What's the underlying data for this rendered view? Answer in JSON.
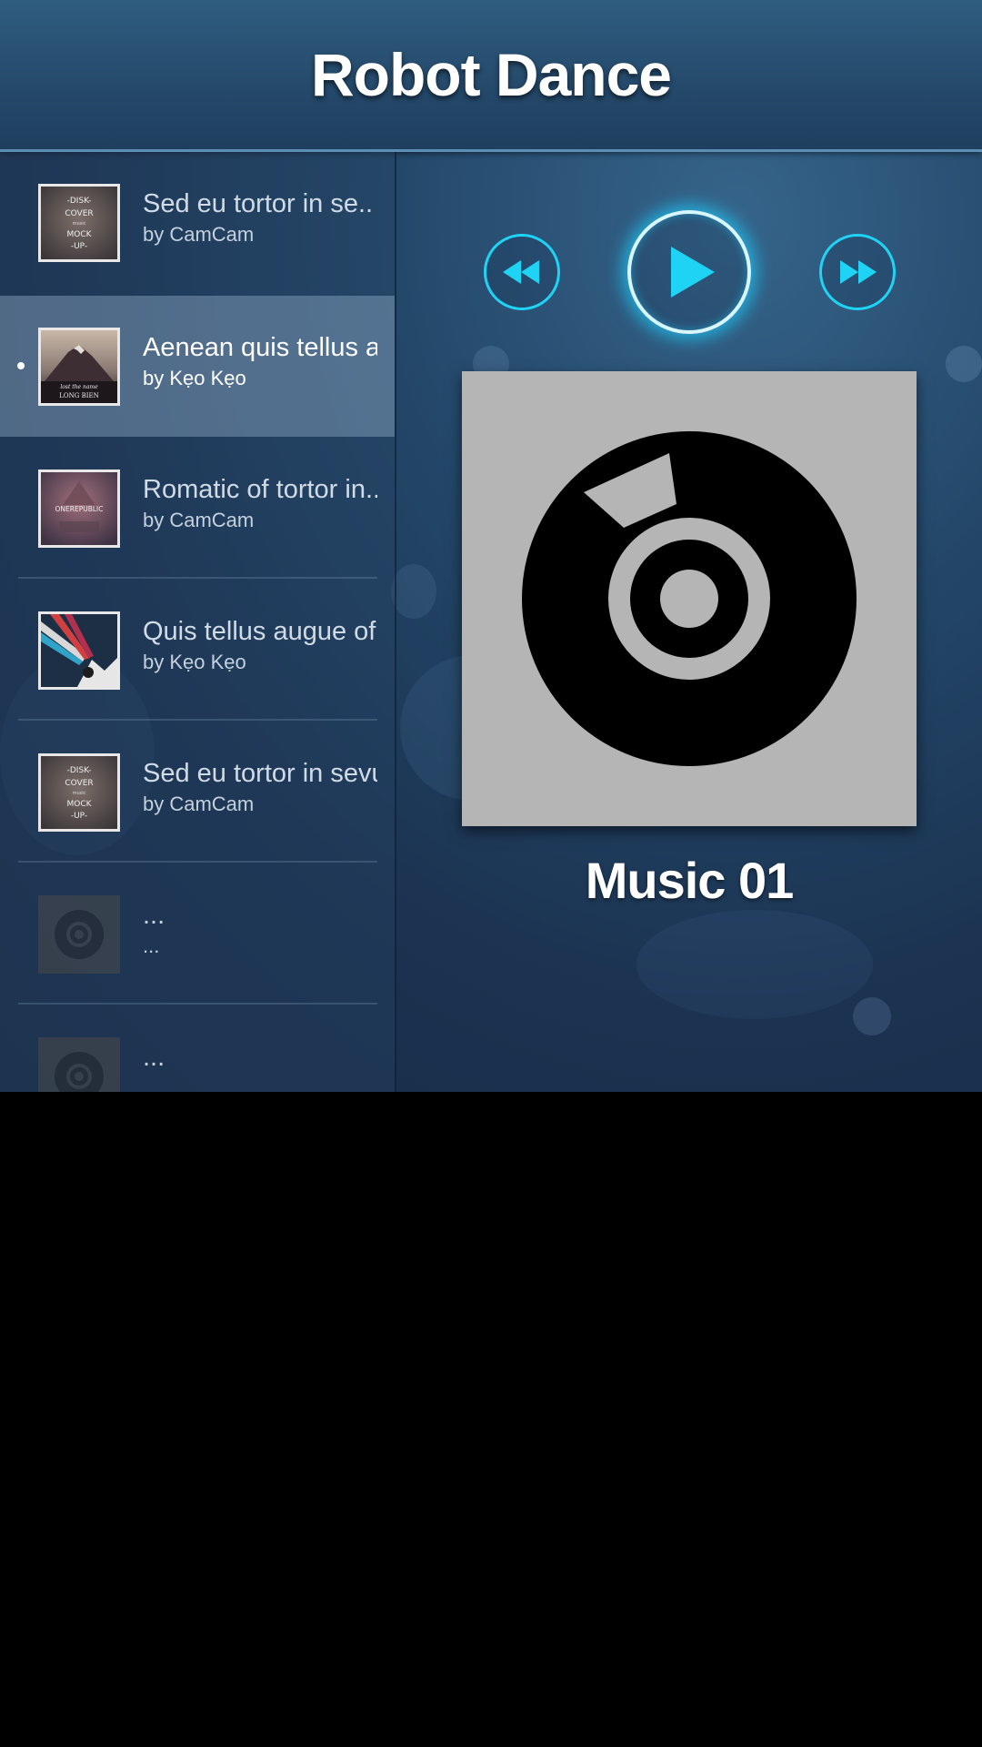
{
  "app": {
    "title": "Robot Dance"
  },
  "playlist": {
    "tracks": [
      {
        "title": "Sed eu tortor in se..",
        "artist": "by CamCam",
        "cover": "disk-cover-mockup",
        "active": false
      },
      {
        "title": "Aenean quis tellus a..",
        "artist": "by Kẹo Kẹo",
        "cover": "mountain-long-bien",
        "active": true
      },
      {
        "title": "Romatic of tortor in..",
        "artist": "by CamCam",
        "cover": "onerepublic",
        "active": false
      },
      {
        "title": "Quis tellus augue of..",
        "artist": "by Kẹo Kẹo",
        "cover": "prism-light",
        "active": false
      },
      {
        "title": "Sed eu tortor in sevu",
        "artist": "by CamCam",
        "cover": "disk-cover-mockup",
        "active": false
      },
      {
        "title": "...",
        "artist": "...",
        "cover": "placeholder-disc",
        "active": false
      },
      {
        "title": "...",
        "artist": "...",
        "cover": "placeholder-disc",
        "active": false
      }
    ]
  },
  "controls": {
    "previous_icon": "rewind-icon",
    "play_icon": "play-icon",
    "next_icon": "fast-forward-icon",
    "accent_color": "#1fd3f5"
  },
  "now_playing": {
    "title": "Music 01",
    "artwork_icon": "music-disc-icon"
  },
  "colors": {
    "background": "#1b3250",
    "header": "#2f5d80",
    "accent": "#1fd3f5"
  }
}
